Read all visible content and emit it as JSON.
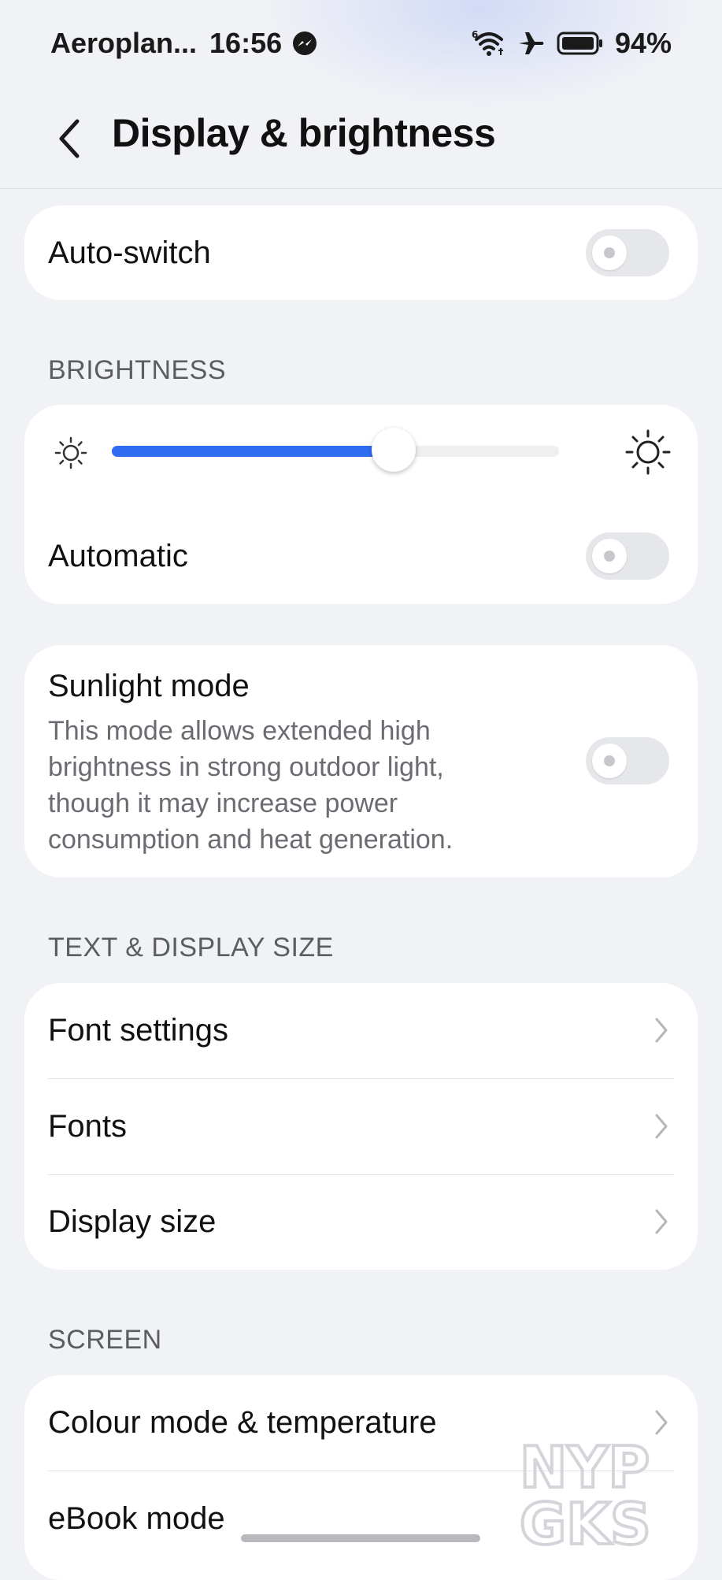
{
  "status_bar": {
    "carrier": "Aeroplan...",
    "time": "16:56",
    "battery": "94%",
    "icons": [
      "messenger-icon",
      "wifi-icon",
      "airplane-icon",
      "battery-icon"
    ]
  },
  "header": {
    "title": "Display & brightness"
  },
  "auto_switch": {
    "label": "Auto-switch",
    "on": false
  },
  "brightness": {
    "section_title": "BRIGHTNESS",
    "level_fraction": 0.63,
    "automatic_label": "Automatic",
    "automatic_on": false
  },
  "sunlight": {
    "title": "Sunlight mode",
    "description": "This mode allows extended high brightness in strong outdoor light, though it may increase power consumption and heat generation.",
    "on": false
  },
  "text_display": {
    "section_title": "TEXT & DISPLAY SIZE",
    "items": [
      {
        "label": "Font settings"
      },
      {
        "label": "Fonts"
      },
      {
        "label": "Display size"
      }
    ]
  },
  "screen": {
    "section_title": "SCREEN",
    "items": [
      {
        "label": "Colour mode & temperature"
      },
      {
        "label": "eBook mode"
      }
    ]
  },
  "watermark": {
    "line1": "NYP",
    "line2": "GKS"
  },
  "colors": {
    "accent": "#2f6df0",
    "background": "#f1f2f6",
    "card": "#ffffff",
    "toggle_off": "#e6e7ea"
  }
}
